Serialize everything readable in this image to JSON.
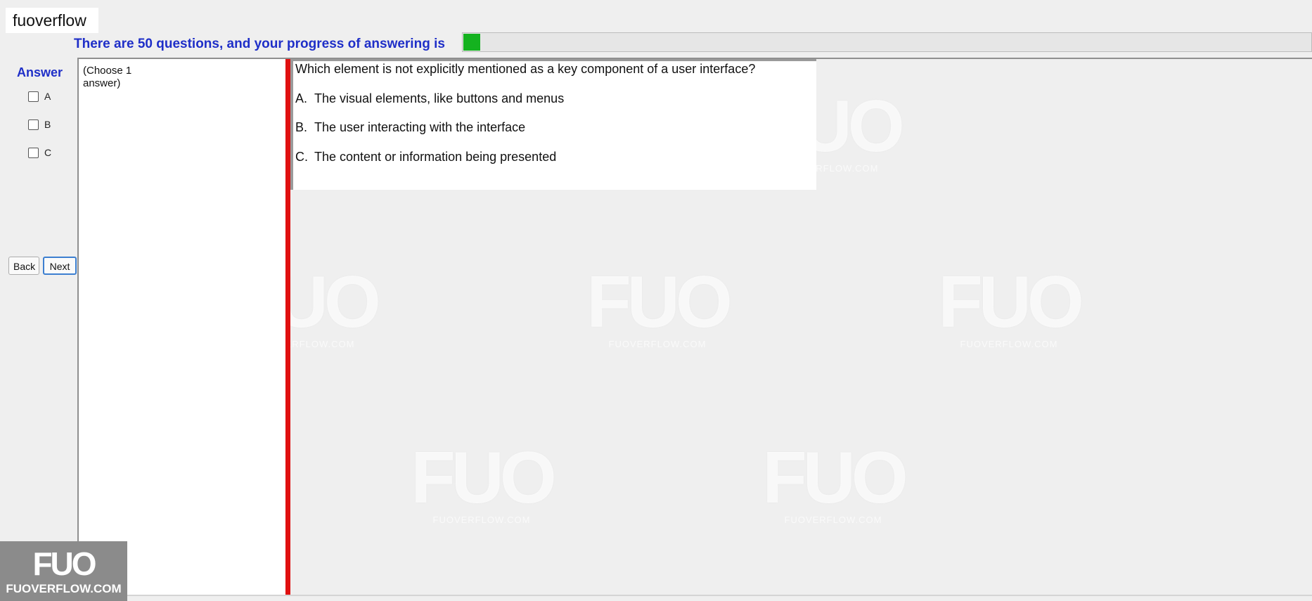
{
  "app": {
    "title": "fuoverflow"
  },
  "progress": {
    "label": "There are 50 questions, and your progress of answering is",
    "fraction": 0.02,
    "color": "#14b21f"
  },
  "answer_panel": {
    "heading": "Answer",
    "options": [
      {
        "label": "A",
        "checked": false
      },
      {
        "label": "B",
        "checked": false
      },
      {
        "label": "C",
        "checked": false
      }
    ]
  },
  "nav": {
    "back_label": "Back",
    "next_label": "Next"
  },
  "instruction": "(Choose 1 answer)",
  "question": {
    "text": "Which element is not explicitly mentioned as a key component of a user interface?",
    "options": [
      {
        "letter": "A.",
        "text": "The visual elements, like buttons and menus"
      },
      {
        "letter": "B.",
        "text": "The user interacting with the interface"
      },
      {
        "letter": "C.",
        "text": "The content or information being presented"
      }
    ]
  },
  "watermark": {
    "logo": "FUO",
    "site": "FUOVERFLOW.COM"
  },
  "colors": {
    "accent_blue": "#1f2fc8",
    "divider_red": "#e01010"
  }
}
